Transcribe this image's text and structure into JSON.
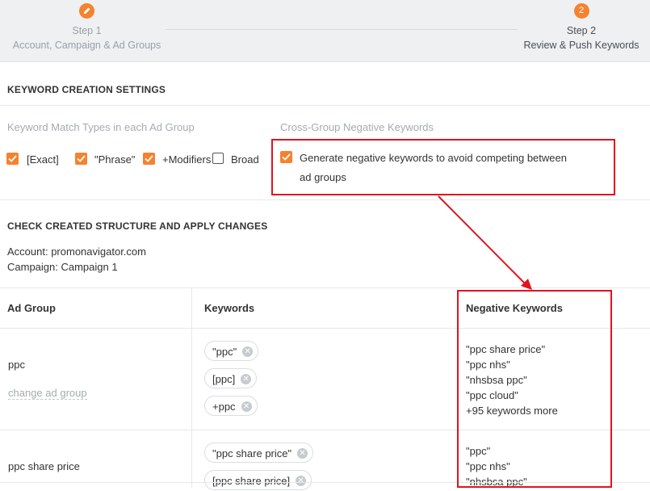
{
  "stepper": {
    "step1": {
      "title": "Step 1",
      "subtitle": "Account, Campaign & Ad Groups"
    },
    "step2": {
      "number": "2",
      "title": "Step 2",
      "subtitle": "Review & Push Keywords"
    }
  },
  "settings": {
    "title": "KEYWORD CREATION SETTINGS",
    "match_types_label": "Keyword Match Types in each Ad Group",
    "match_types": [
      {
        "label": "[Exact]",
        "checked": true
      },
      {
        "label": "\"Phrase\"",
        "checked": true
      },
      {
        "label": "+Modifiers",
        "checked": true
      },
      {
        "label": "Broad",
        "checked": false
      }
    ],
    "cross_group_label": "Cross-Group Negative Keywords",
    "negative_option_line1": "Generate negative keywords to avoid competing between",
    "negative_option_line2": "ad groups"
  },
  "structure": {
    "title": "CHECK CREATED STRUCTURE AND APPLY CHANGES",
    "account_line": "Account: promonavigator.com",
    "campaign_line": "Campaign: Campaign 1"
  },
  "table": {
    "headers": {
      "ad_group": "Ad Group",
      "keywords": "Keywords",
      "negative": "Negative Keywords"
    },
    "rows": [
      {
        "ad_group": "ppc",
        "change_link": "change ad group",
        "keywords": [
          "\"ppc\"",
          "[ppc]",
          "+ppc"
        ],
        "negatives": [
          "\"ppc share price\"",
          "\"ppc nhs\"",
          "\"nhsbsa ppc\"",
          "\"ppc cloud\""
        ],
        "more": "+95 keywords more"
      },
      {
        "ad_group": "ppc share price",
        "keywords": [
          "\"ppc share price\"",
          "[ppc share price]"
        ],
        "negatives": [
          "\"ppc\"",
          "\"ppc nhs\"",
          "\"nhsbsa ppc\""
        ]
      }
    ]
  },
  "colors": {
    "accent": "#f5822f",
    "annotation": "#e0141e"
  },
  "icons": {
    "step1": "pencil-icon",
    "remove": "close-icon",
    "check": "check-icon"
  }
}
